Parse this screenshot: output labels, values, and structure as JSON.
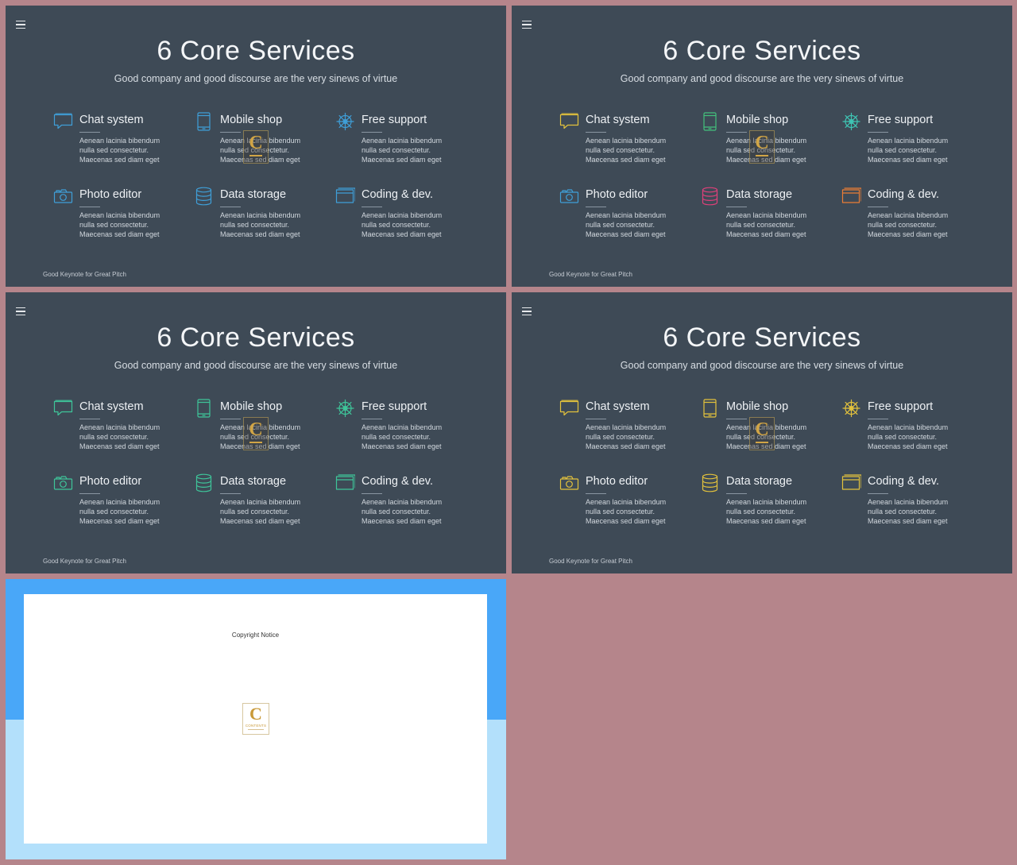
{
  "slides": [
    {
      "title": "6 Core Services",
      "subtitle": "Good company and good discourse are the very sinews of virtue",
      "footer": "Good Keynote for Great Pitch",
      "icon_colors": [
        "#3f9fd8",
        "#3f9fd8",
        "#3f9fd8",
        "#3f9fd8",
        "#3f9fd8",
        "#3f9fd8"
      ]
    },
    {
      "title": "6 Core Services",
      "subtitle": "Good company and good discourse are the very sinews of virtue",
      "footer": "Good Keynote for Great Pitch",
      "icon_colors": [
        "#e3c23c",
        "#43c07c",
        "#3ec5b4",
        "#3f9fd8",
        "#e0407a",
        "#ea7d35"
      ]
    },
    {
      "title": "6 Core Services",
      "subtitle": "Good company and good discourse are the very sinews of virtue",
      "footer": "Good Keynote for Great Pitch",
      "icon_colors": [
        "#3ec59a",
        "#3ec59a",
        "#3ec59a",
        "#3ec59a",
        "#3ec59a",
        "#3ec59a"
      ]
    },
    {
      "title": "6 Core Services",
      "subtitle": "Good company and good discourse are the very sinews of virtue",
      "footer": "Good Keynote for Great Pitch",
      "icon_colors": [
        "#e3c23c",
        "#e3c23c",
        "#e3c23c",
        "#e3c23c",
        "#e3c23c",
        "#e3c23c"
      ]
    }
  ],
  "services": [
    {
      "name": "Chat system",
      "icon": "chat-icon",
      "desc": [
        "Aenean lacinia bibendum",
        "nulla sed consectetur.",
        "Maecenas sed diam eget"
      ]
    },
    {
      "name": "Mobile shop",
      "icon": "mobile-icon",
      "desc": [
        "Aenean lacinia bibendum",
        "nulla sed consectetur.",
        "Maecenas sed diam eget"
      ]
    },
    {
      "name": "Free support",
      "icon": "helm-icon",
      "desc": [
        "Aenean lacinia bibendum",
        "nulla sed consectetur.",
        "Maecenas sed diam eget"
      ]
    },
    {
      "name": "Photo editor",
      "icon": "camera-icon",
      "desc": [
        "Aenean lacinia bibendum",
        "nulla sed consectetur.",
        "Maecenas sed diam eget"
      ]
    },
    {
      "name": "Data storage",
      "icon": "database-icon",
      "desc": [
        "Aenean lacinia bibendum",
        "nulla sed consectetur.",
        "Maecenas sed diam eget"
      ]
    },
    {
      "name": "Coding & dev.",
      "icon": "browser-window-icon",
      "desc": [
        "Aenean lacinia bibendum",
        "nulla sed consectetur.",
        "Maecenas sed diam eget"
      ]
    }
  ],
  "copyright": {
    "notice": "Copyright Notice",
    "logo_letter": "C",
    "logo_wordmark": "CONTENTS"
  },
  "colors": {
    "page_background": "#b5858b",
    "slide_background": "#3e4a56",
    "copyright_top_band": "#49a7f8",
    "copyright_bottom_band": "#b3e0fb"
  }
}
